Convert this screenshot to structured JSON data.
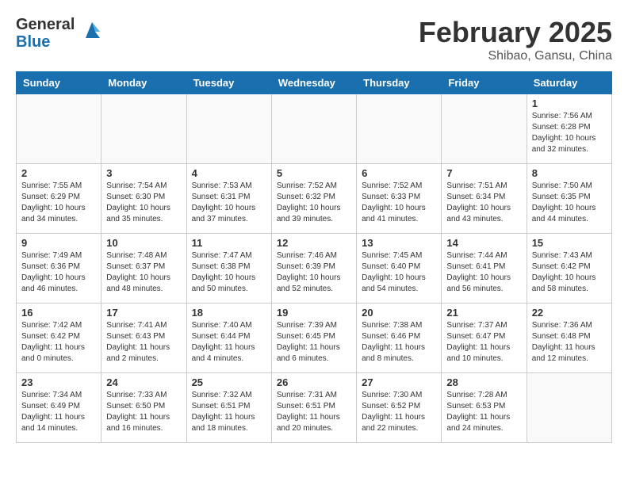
{
  "header": {
    "logo_general": "General",
    "logo_blue": "Blue",
    "month_title": "February 2025",
    "location": "Shibao, Gansu, China"
  },
  "weekdays": [
    "Sunday",
    "Monday",
    "Tuesday",
    "Wednesday",
    "Thursday",
    "Friday",
    "Saturday"
  ],
  "weeks": [
    [
      {
        "num": "",
        "info": ""
      },
      {
        "num": "",
        "info": ""
      },
      {
        "num": "",
        "info": ""
      },
      {
        "num": "",
        "info": ""
      },
      {
        "num": "",
        "info": ""
      },
      {
        "num": "",
        "info": ""
      },
      {
        "num": "1",
        "info": "Sunrise: 7:56 AM\nSunset: 6:28 PM\nDaylight: 10 hours\nand 32 minutes."
      }
    ],
    [
      {
        "num": "2",
        "info": "Sunrise: 7:55 AM\nSunset: 6:29 PM\nDaylight: 10 hours\nand 34 minutes."
      },
      {
        "num": "3",
        "info": "Sunrise: 7:54 AM\nSunset: 6:30 PM\nDaylight: 10 hours\nand 35 minutes."
      },
      {
        "num": "4",
        "info": "Sunrise: 7:53 AM\nSunset: 6:31 PM\nDaylight: 10 hours\nand 37 minutes."
      },
      {
        "num": "5",
        "info": "Sunrise: 7:52 AM\nSunset: 6:32 PM\nDaylight: 10 hours\nand 39 minutes."
      },
      {
        "num": "6",
        "info": "Sunrise: 7:52 AM\nSunset: 6:33 PM\nDaylight: 10 hours\nand 41 minutes."
      },
      {
        "num": "7",
        "info": "Sunrise: 7:51 AM\nSunset: 6:34 PM\nDaylight: 10 hours\nand 43 minutes."
      },
      {
        "num": "8",
        "info": "Sunrise: 7:50 AM\nSunset: 6:35 PM\nDaylight: 10 hours\nand 44 minutes."
      }
    ],
    [
      {
        "num": "9",
        "info": "Sunrise: 7:49 AM\nSunset: 6:36 PM\nDaylight: 10 hours\nand 46 minutes."
      },
      {
        "num": "10",
        "info": "Sunrise: 7:48 AM\nSunset: 6:37 PM\nDaylight: 10 hours\nand 48 minutes."
      },
      {
        "num": "11",
        "info": "Sunrise: 7:47 AM\nSunset: 6:38 PM\nDaylight: 10 hours\nand 50 minutes."
      },
      {
        "num": "12",
        "info": "Sunrise: 7:46 AM\nSunset: 6:39 PM\nDaylight: 10 hours\nand 52 minutes."
      },
      {
        "num": "13",
        "info": "Sunrise: 7:45 AM\nSunset: 6:40 PM\nDaylight: 10 hours\nand 54 minutes."
      },
      {
        "num": "14",
        "info": "Sunrise: 7:44 AM\nSunset: 6:41 PM\nDaylight: 10 hours\nand 56 minutes."
      },
      {
        "num": "15",
        "info": "Sunrise: 7:43 AM\nSunset: 6:42 PM\nDaylight: 10 hours\nand 58 minutes."
      }
    ],
    [
      {
        "num": "16",
        "info": "Sunrise: 7:42 AM\nSunset: 6:42 PM\nDaylight: 11 hours\nand 0 minutes."
      },
      {
        "num": "17",
        "info": "Sunrise: 7:41 AM\nSunset: 6:43 PM\nDaylight: 11 hours\nand 2 minutes."
      },
      {
        "num": "18",
        "info": "Sunrise: 7:40 AM\nSunset: 6:44 PM\nDaylight: 11 hours\nand 4 minutes."
      },
      {
        "num": "19",
        "info": "Sunrise: 7:39 AM\nSunset: 6:45 PM\nDaylight: 11 hours\nand 6 minutes."
      },
      {
        "num": "20",
        "info": "Sunrise: 7:38 AM\nSunset: 6:46 PM\nDaylight: 11 hours\nand 8 minutes."
      },
      {
        "num": "21",
        "info": "Sunrise: 7:37 AM\nSunset: 6:47 PM\nDaylight: 11 hours\nand 10 minutes."
      },
      {
        "num": "22",
        "info": "Sunrise: 7:36 AM\nSunset: 6:48 PM\nDaylight: 11 hours\nand 12 minutes."
      }
    ],
    [
      {
        "num": "23",
        "info": "Sunrise: 7:34 AM\nSunset: 6:49 PM\nDaylight: 11 hours\nand 14 minutes."
      },
      {
        "num": "24",
        "info": "Sunrise: 7:33 AM\nSunset: 6:50 PM\nDaylight: 11 hours\nand 16 minutes."
      },
      {
        "num": "25",
        "info": "Sunrise: 7:32 AM\nSunset: 6:51 PM\nDaylight: 11 hours\nand 18 minutes."
      },
      {
        "num": "26",
        "info": "Sunrise: 7:31 AM\nSunset: 6:51 PM\nDaylight: 11 hours\nand 20 minutes."
      },
      {
        "num": "27",
        "info": "Sunrise: 7:30 AM\nSunset: 6:52 PM\nDaylight: 11 hours\nand 22 minutes."
      },
      {
        "num": "28",
        "info": "Sunrise: 7:28 AM\nSunset: 6:53 PM\nDaylight: 11 hours\nand 24 minutes."
      },
      {
        "num": "",
        "info": ""
      }
    ]
  ]
}
